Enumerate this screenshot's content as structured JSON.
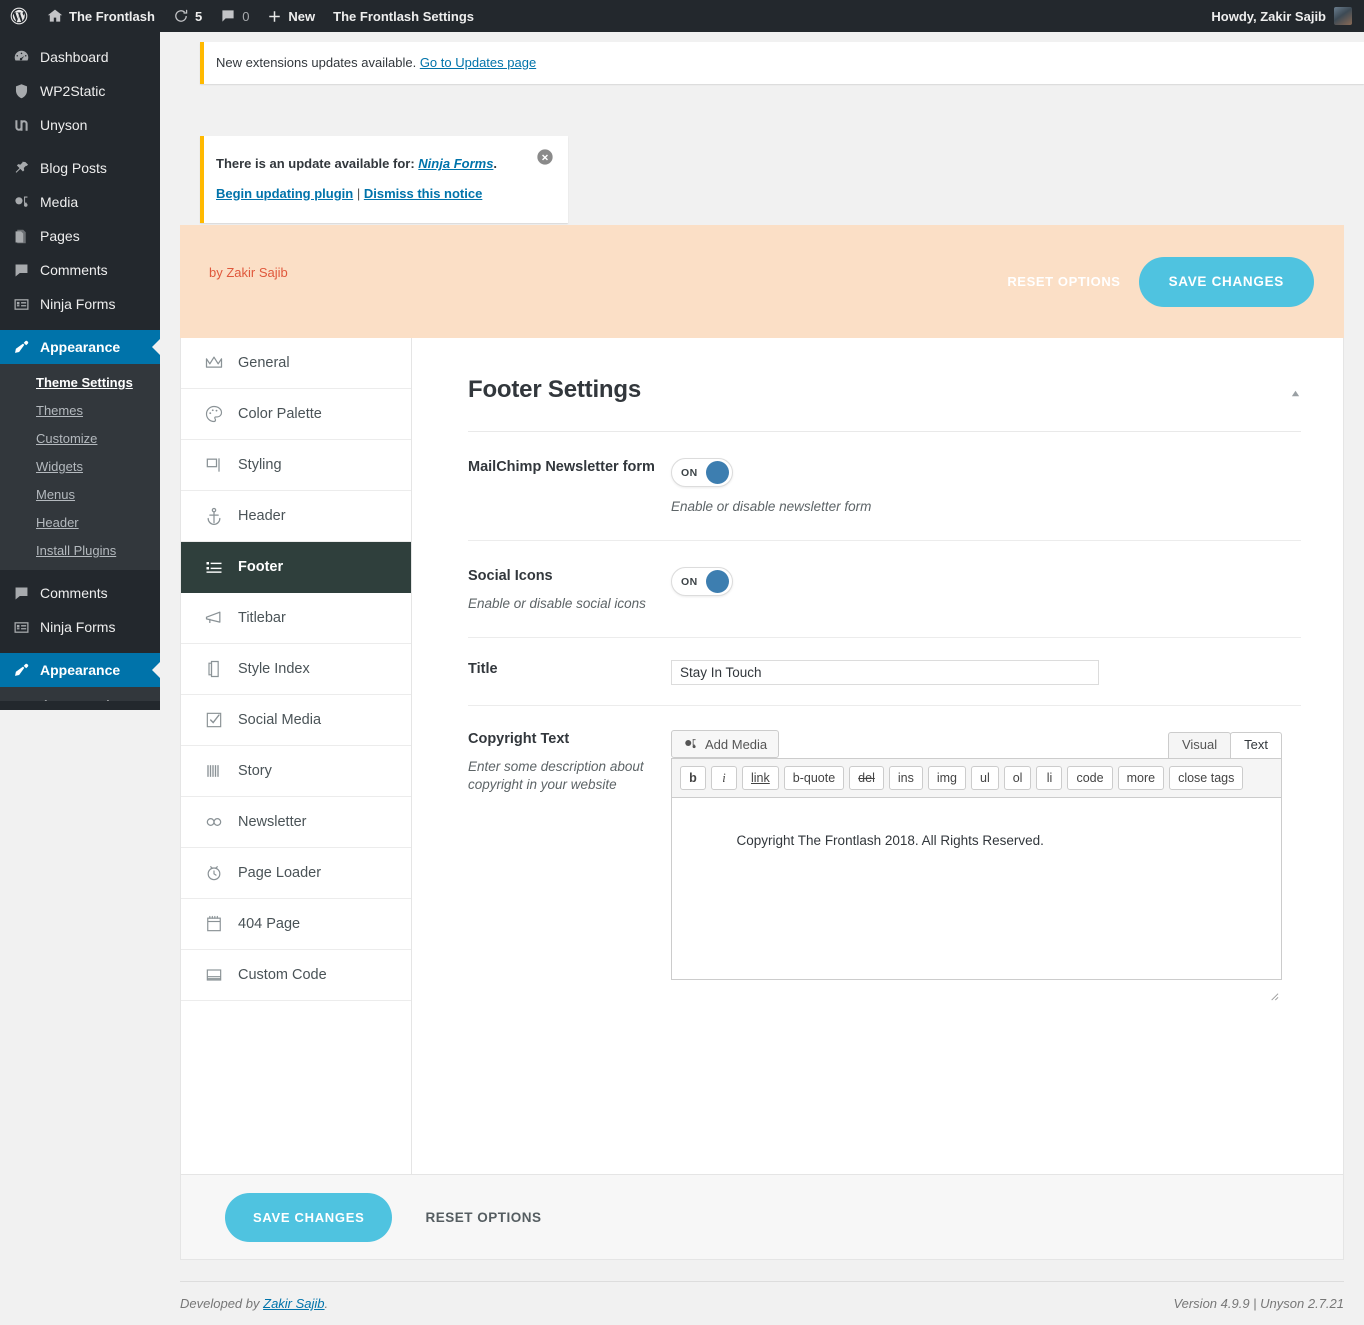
{
  "adminbar": {
    "wp_logo": "wordpress-logo-icon",
    "site_name": "The Frontlash",
    "updates_count": "5",
    "comments_count": "0",
    "new_label": "New",
    "page_link": "The Frontlash Settings",
    "howdy": "Howdy, Zakir Sajib"
  },
  "sidebar": {
    "items": [
      {
        "label": "Dashboard",
        "icon": "dashboard-icon",
        "current": false
      },
      {
        "label": "WP2Static",
        "icon": "shield-icon",
        "current": false
      },
      {
        "label": "Unyson",
        "icon": "unyson-icon",
        "current": false
      },
      {
        "label": "Blog Posts",
        "icon": "pin-icon",
        "current": false
      },
      {
        "label": "Media",
        "icon": "media-icon",
        "current": false
      },
      {
        "label": "Pages",
        "icon": "pages-icon",
        "current": false
      },
      {
        "label": "Comments",
        "icon": "comment-icon",
        "current": false
      },
      {
        "label": "Ninja Forms",
        "icon": "forms-icon",
        "current": false
      },
      {
        "label": "Appearance",
        "icon": "brush-icon",
        "current": true
      }
    ],
    "submenu": [
      {
        "label": "Theme Settings",
        "active": true
      },
      {
        "label": "Themes",
        "active": false
      },
      {
        "label": "Customize",
        "active": false
      },
      {
        "label": "Widgets",
        "active": false
      },
      {
        "label": "Menus",
        "active": false
      },
      {
        "label": "Header",
        "active": false
      },
      {
        "label": "Install Plugins",
        "active": false
      }
    ],
    "items2": [
      {
        "label": "Comments",
        "icon": "comment-icon",
        "current": false
      },
      {
        "label": "Ninja Forms",
        "icon": "forms-icon",
        "current": false
      },
      {
        "label": "Appearance",
        "icon": "brush-icon",
        "current": true
      }
    ]
  },
  "notices": {
    "extensions": {
      "text": "New extensions updates available.",
      "link": "Go to Updates page"
    },
    "plugin": {
      "prefix": "There is an update available for:",
      "plugin_name": "Ninja Forms",
      "suffix": ".",
      "begin_link": "Begin updating plugin",
      "separator": "|",
      "dismiss_link": "Dismiss this notice",
      "close_icon": "close-circle-icon"
    }
  },
  "options_header": {
    "byline": "by Zakir Sajib",
    "reset_label": "RESET OPTIONS",
    "save_label": "SAVE CHANGES",
    "background": "#fbdfc6",
    "accent": "#4fc3e0",
    "byline_color": "#e0583c"
  },
  "tabs": [
    {
      "label": "General",
      "icon": "crown-icon",
      "active": false
    },
    {
      "label": "Color Palette",
      "icon": "palette-icon",
      "active": false
    },
    {
      "label": "Styling",
      "icon": "flag-icon",
      "active": false
    },
    {
      "label": "Header",
      "icon": "anchor-icon",
      "active": false
    },
    {
      "label": "Footer",
      "icon": "footer-list-icon",
      "active": true
    },
    {
      "label": "Titlebar",
      "icon": "megaphone-icon",
      "active": false
    },
    {
      "label": "Style Index",
      "icon": "document-icon",
      "active": false
    },
    {
      "label": "Social Media",
      "icon": "checkbox-icon",
      "active": false
    },
    {
      "label": "Story",
      "icon": "barcode-icon",
      "active": false
    },
    {
      "label": "Newsletter",
      "icon": "infinity-icon",
      "active": false
    },
    {
      "label": "Page Loader",
      "icon": "timer-icon",
      "active": false
    },
    {
      "label": "404 Page",
      "icon": "notepad-icon",
      "active": false
    },
    {
      "label": "Custom Code",
      "icon": "code-block-icon",
      "active": false
    }
  ],
  "panel": {
    "title": "Footer Settings",
    "collapse_icon": "caret-up-icon",
    "rows": {
      "mailchimp": {
        "label": "MailChimp Newsletter form",
        "toggle_state": "ON",
        "description": "Enable or disable newsletter form"
      },
      "social_icons": {
        "label": "Social Icons",
        "description": "Enable or disable social icons",
        "toggle_state": "ON"
      },
      "title": {
        "label": "Title",
        "value": "Stay In Touch",
        "placeholder": ""
      },
      "copyright": {
        "label": "Copyright Text",
        "description": "Enter some description about copyright in your website",
        "add_media_label": "Add Media",
        "add_media_icon": "media-icon",
        "editor_tabs": [
          {
            "label": "Visual",
            "selected": false
          },
          {
            "label": "Text",
            "selected": true
          }
        ],
        "quicktags": [
          "b",
          "i",
          "link",
          "b-quote",
          "del",
          "ins",
          "img",
          "ul",
          "ol",
          "li",
          "code",
          "more",
          "close tags"
        ],
        "content": "Copyright The Frontlash 2018. All Rights Reserved."
      }
    }
  },
  "options_footer": {
    "save_label": "SAVE CHANGES",
    "reset_label": "RESET OPTIONS"
  },
  "page_footer": {
    "developed_prefix": "Developed by",
    "developer": "Zakir Sajib",
    "developed_suffix": ".",
    "version": "Version 4.9.9 | Unyson 2.7.21"
  }
}
